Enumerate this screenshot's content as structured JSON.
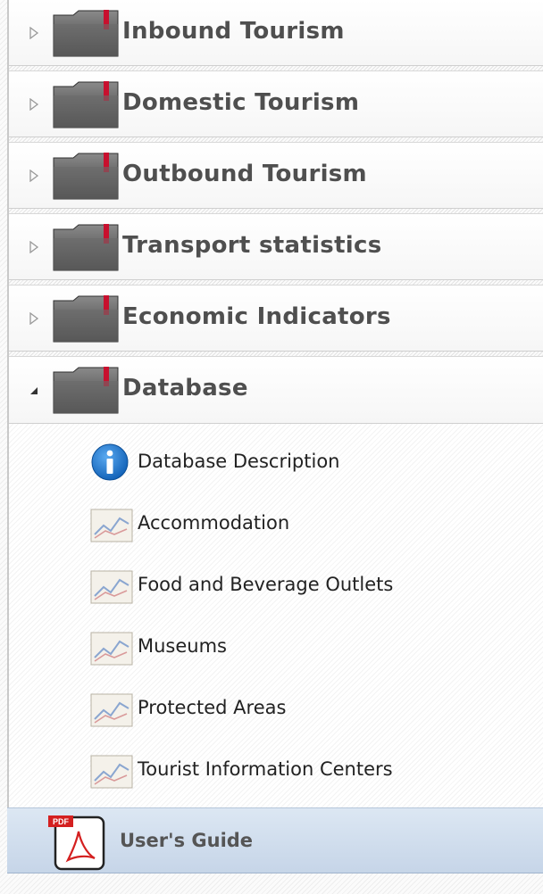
{
  "categories": [
    {
      "label": "Inbound Tourism",
      "expanded": false,
      "arrow_icon": "triangle-right-icon",
      "folder_icon": "folder-icon"
    },
    {
      "label": "Domestic Tourism",
      "expanded": false,
      "arrow_icon": "triangle-right-icon",
      "folder_icon": "folder-icon"
    },
    {
      "label": "Outbound Tourism",
      "expanded": false,
      "arrow_icon": "triangle-right-icon",
      "folder_icon": "folder-icon"
    },
    {
      "label": "Transport statistics",
      "expanded": false,
      "arrow_icon": "triangle-right-icon",
      "folder_icon": "folder-icon"
    },
    {
      "label": "Economic Indicators",
      "expanded": false,
      "arrow_icon": "triangle-right-icon",
      "folder_icon": "folder-icon"
    },
    {
      "label": "Database",
      "expanded": true,
      "arrow_icon": "triangle-down-icon",
      "folder_icon": "folder-icon"
    }
  ],
  "database_items": [
    {
      "label": "Database Description",
      "icon": "info-icon"
    },
    {
      "label": "Accommodation",
      "icon": "chart-icon"
    },
    {
      "label": "Food and Beverage Outlets",
      "icon": "chart-icon"
    },
    {
      "label": "Museums",
      "icon": "chart-icon"
    },
    {
      "label": "Protected Areas",
      "icon": "chart-icon"
    },
    {
      "label": "Tourist Information Centers",
      "icon": "chart-icon"
    }
  ],
  "users_guide": {
    "label": "User's Guide",
    "icon": "pdf-icon",
    "badge": "PDF"
  },
  "colors": {
    "folder_accent": "#c8102e",
    "folder_body": "#555555",
    "info_blue": "#1a73c8",
    "guide_bg": "#cfdcec"
  }
}
